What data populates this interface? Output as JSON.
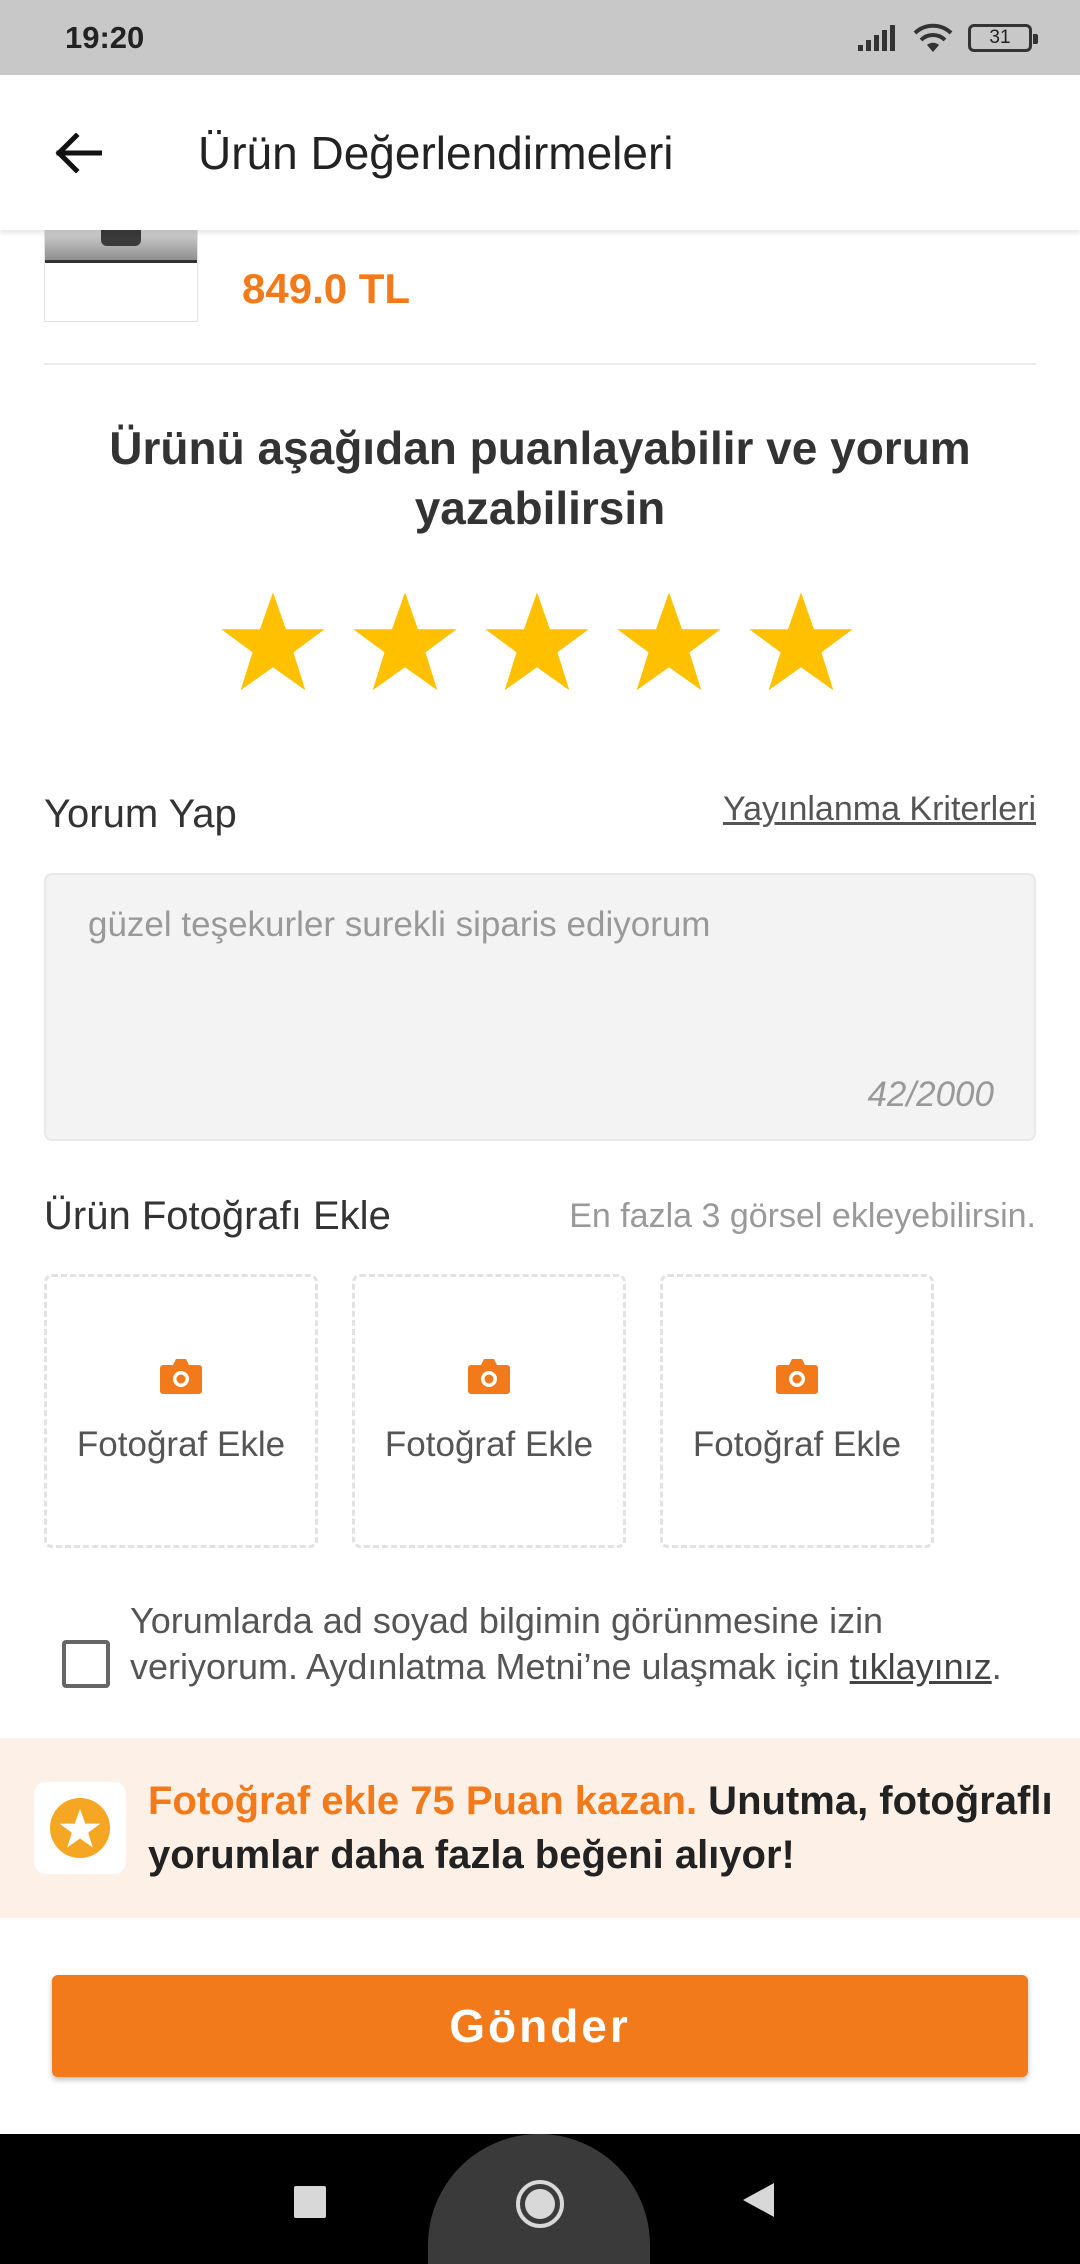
{
  "status_bar": {
    "time": "19:20",
    "battery": "31"
  },
  "header": {
    "title": "Ürün Değerlendirmeleri"
  },
  "product": {
    "price": "849.0 TL"
  },
  "rating": {
    "prompt": "Ürünü aşağıdan puanlayabilir ve yorum yazabilirsin",
    "stars": 5,
    "max_stars": 5,
    "star_color": "#ffc000"
  },
  "comment": {
    "section_label": "Yorum Yap",
    "criteria_link": "Yayınlanma Kriterleri",
    "value": "güzel teşekurler surekli siparis ediyorum",
    "counter": "42/2000"
  },
  "photos": {
    "section_label": "Ürün Fotoğrafı Ekle",
    "hint": "En fazla 3 görsel ekleyebilirsin.",
    "slots": [
      {
        "label": "Fotoğraf Ekle",
        "icon": "camera-icon"
      },
      {
        "label": "Fotoğraf Ekle",
        "icon": "camera-icon"
      },
      {
        "label": "Fotoğraf Ekle",
        "icon": "camera-icon"
      }
    ]
  },
  "consent": {
    "checked": false,
    "text": "Yorumlarda ad soyad bilgimin görünmesine izin veriyorum. Aydınlatma Metni’ne ulaşmak için ",
    "link": "tıklayınız",
    "suffix": "."
  },
  "promo": {
    "highlight": "Fotoğraf ekle 75 Puan kazan.",
    "text": " Unutma, fotoğraflı yorumlar daha fazla beğeni alıyor!",
    "icon": "star-badge-icon"
  },
  "submit": {
    "label": "Gönder"
  },
  "colors": {
    "accent": "#f27a1a",
    "star": "#ffc000",
    "promo_bg": "#fdf0e6"
  }
}
